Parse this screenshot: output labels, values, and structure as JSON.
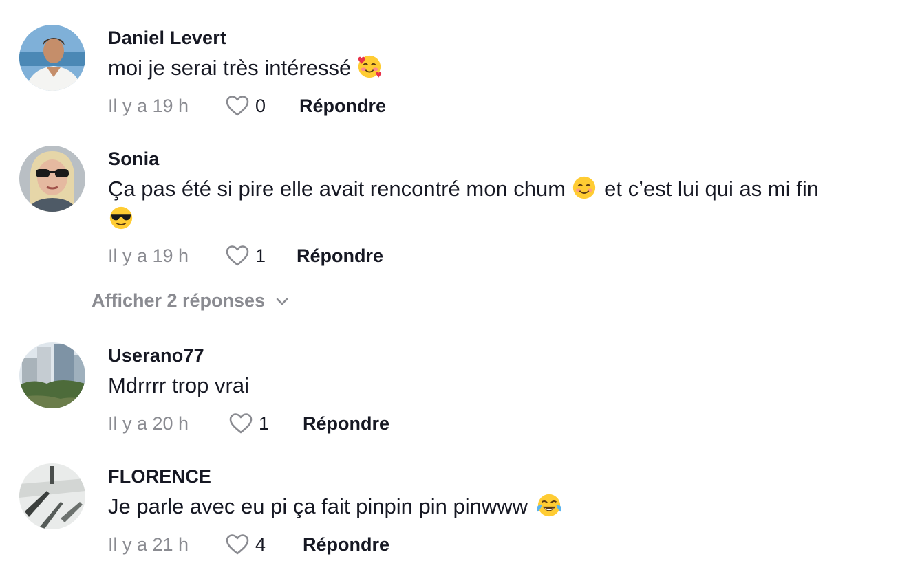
{
  "comments": [
    {
      "username": "Daniel Levert",
      "text": "moi je serai très intéressé",
      "emoji": "smiling-face-with-hearts-icon",
      "time": "Il y a 19 h",
      "likes": "0",
      "reply_label": "Répondre"
    },
    {
      "username": "Sonia",
      "text": "Ça pas été si pire elle avait rencontré mon chum",
      "text_emoji": "smiling-face-icon",
      "text_cont": "et c’est lui qui as mi fin",
      "emoji": "sunglasses-face-icon",
      "time": "Il y a 19 h",
      "likes": "1",
      "reply_label": "Répondre",
      "view_replies": "Afficher 2 réponses"
    },
    {
      "username": "Userano77",
      "text": "Mdrrrr trop vrai",
      "time": "Il y a 20 h",
      "likes": "1",
      "reply_label": "Répondre"
    },
    {
      "username": "FLORENCE",
      "text": "Je parle avec eu pi ça fait pinpin pin pinwww",
      "emoji": "tears-of-joy-icon",
      "time": "Il y a 21 h",
      "likes": "4",
      "reply_label": "Répondre"
    }
  ],
  "colors": {
    "text": "#161823",
    "muted": "#8a8b91",
    "background": "#ffffff"
  }
}
